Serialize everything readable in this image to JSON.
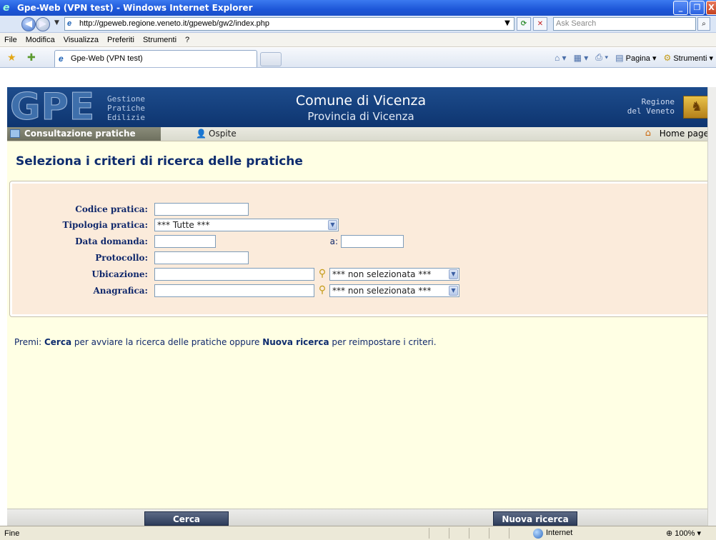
{
  "window": {
    "title": "Gpe-Web (VPN test) - Windows Internet Explorer",
    "buttons": [
      "_",
      "❐",
      "X"
    ]
  },
  "address": {
    "url": "http://gpeweb.regione.veneto.it/gpeweb/gw2/index.php",
    "search_placeholder": "Ask Search"
  },
  "menu": [
    "File",
    "Modifica",
    "Visualizza",
    "Preferiti",
    "Strumenti",
    "?"
  ],
  "tab": {
    "label": "Gpe-Web (VPN test)"
  },
  "commandbar": {
    "pagina": "Pagina",
    "strumenti": "Strumenti"
  },
  "header": {
    "logo": "GPE",
    "logo_sub": [
      "Gestione",
      "Pratiche",
      "Edilizie"
    ],
    "comune": "Comune di Vicenza",
    "provincia": "Provincia di Vicenza",
    "regione": [
      "Regione",
      "del Veneto"
    ]
  },
  "subnav": {
    "section": "Consultazione pratiche",
    "user": "Ospite",
    "home": "Home page"
  },
  "page": {
    "title": "Seleziona i criteri di ricerca delle pratiche",
    "form": {
      "codice_label": "Codice pratica:",
      "codice_value": "",
      "tipologia_label": "Tipologia pratica:",
      "tipologia_value": "*** Tutte ***",
      "data_label": "Data domanda:",
      "data_from": "",
      "data_a_label": "a:",
      "data_to": "",
      "protocollo_label": "Protocollo:",
      "protocollo_value": "",
      "ubicazione_label": "Ubicazione:",
      "ubicazione_value": "",
      "ubicazione_select": "*** non selezionata ***",
      "anagrafica_label": "Anagrafica:",
      "anagrafica_value": "",
      "anagrafica_select": "*** non selezionata ***"
    },
    "hint": {
      "premi": "Premi:",
      "cerca": "Cerca",
      "mid": "per avviare la ricerca delle pratiche oppure",
      "nuova": "Nuova ricerca",
      "end": "per reimpostare i criteri."
    }
  },
  "buttons": {
    "cerca": "Cerca",
    "nuova": "Nuova ricerca"
  },
  "status": {
    "text": "Fine",
    "zone": "Internet",
    "zoom": "100%"
  }
}
